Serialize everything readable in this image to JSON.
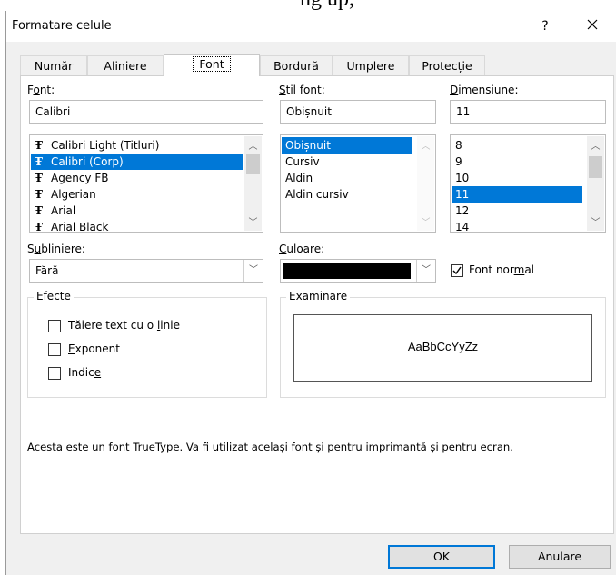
{
  "background_text": "ng up,",
  "dialog": {
    "title": "Formatare celule",
    "help_label": "?",
    "close_label": "✕"
  },
  "tabs": [
    {
      "label": "Număr"
    },
    {
      "label": "Aliniere"
    },
    {
      "label": "Font",
      "active": true
    },
    {
      "label": "Bordură"
    },
    {
      "label": "Umplere"
    },
    {
      "label": "Protecție"
    }
  ],
  "font": {
    "label_pre": "F",
    "label_u": "o",
    "label_post": "nt:",
    "value": "Calibri",
    "items": [
      {
        "label": "Calibri Light (Titluri)",
        "icon": "truetype-icon"
      },
      {
        "label": "Calibri (Corp)",
        "icon": "truetype-icon",
        "selected": true
      },
      {
        "label": "Agency FB",
        "icon": "truetype-icon"
      },
      {
        "label": "Algerian",
        "icon": "truetype-icon"
      },
      {
        "label": "Arial",
        "icon": "truetype-icon"
      },
      {
        "label": "Arial Black",
        "icon": "truetype-icon"
      }
    ]
  },
  "style": {
    "label_u": "S",
    "label_post": "til font:",
    "value": "Obișnuit",
    "items": [
      {
        "label": "Obișnuit",
        "selected": true
      },
      {
        "label": "Cursiv"
      },
      {
        "label": "Aldin"
      },
      {
        "label": "Aldin cursiv"
      }
    ]
  },
  "size": {
    "label_u": "D",
    "label_post": "imensiune:",
    "value": "11",
    "items": [
      {
        "label": "8"
      },
      {
        "label": "9"
      },
      {
        "label": "10"
      },
      {
        "label": "11",
        "selected": true
      },
      {
        "label": "12"
      },
      {
        "label": "14"
      }
    ]
  },
  "underline": {
    "label_pre": "S",
    "label_u": "u",
    "label_post": "bliniere:",
    "value": "Fără"
  },
  "color": {
    "label_u": "C",
    "label_post": "uloare:",
    "swatch": "#000000"
  },
  "normal_font": {
    "label_pre": "Font nor",
    "label_u": "m",
    "label_post": "al",
    "checked": true
  },
  "effects": {
    "title": "Efecte",
    "strike": {
      "pre": "Tăiere text cu o ",
      "u": "l",
      "post": "inie",
      "checked": false
    },
    "superscript": {
      "pre": "",
      "u": "E",
      "post": "xponent",
      "checked": false
    },
    "subscript": {
      "pre": "Indic",
      "u": "e",
      "post": "",
      "checked": false
    }
  },
  "preview": {
    "title": "Examinare",
    "sample": "AaBbCcYyZz"
  },
  "info_text": "Acesta este un font TrueType. Va fi utilizat același font și pentru imprimantă și pentru ecran.",
  "buttons": {
    "ok": "OK",
    "cancel": "Anulare"
  },
  "colors": {
    "accent": "#0078d7",
    "dialog_bg": "#f0f0f0",
    "panel_bg": "#ffffff"
  }
}
